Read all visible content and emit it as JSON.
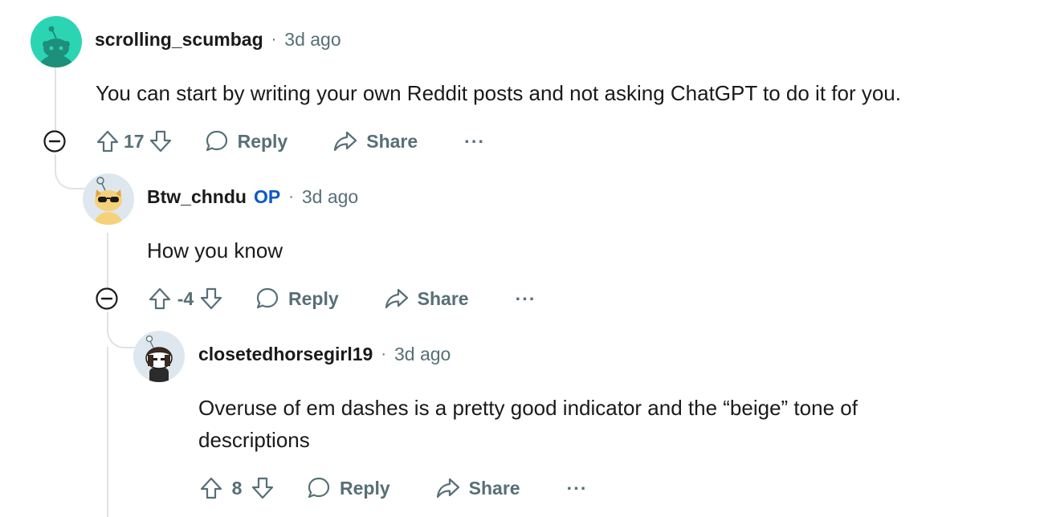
{
  "comments": [
    {
      "username": "scrolling_scumbag",
      "op_badge": "",
      "separator": "·",
      "time": "3d ago",
      "body": "You can start by writing your own Reddit posts and not asking ChatGPT to do it for you.",
      "votes": "17",
      "reply_label": "Reply",
      "share_label": "Share",
      "more_label": "···",
      "avatar_color": "#2bd5b3"
    },
    {
      "username": "Btw_chndu",
      "op_badge": "OP",
      "separator": "·",
      "time": "3d ago",
      "body": "How you know",
      "votes": "-4",
      "reply_label": "Reply",
      "share_label": "Share",
      "more_label": "···",
      "avatar_color": "#dfe7ee"
    },
    {
      "username": "closetedhorsegirl19",
      "op_badge": "",
      "separator": "·",
      "time": "3d ago",
      "body": "Overuse of em dashes is a pretty good indicator and the “beige” tone of descriptions",
      "votes": "8",
      "reply_label": "Reply",
      "share_label": "Share",
      "more_label": "···",
      "avatar_color": "#dfe7ee"
    }
  ],
  "colors": {
    "text": "#1a1a1b",
    "muted": "#576f76",
    "op_badge": "#0a58ca",
    "thread_line": "#dfe3e6"
  }
}
